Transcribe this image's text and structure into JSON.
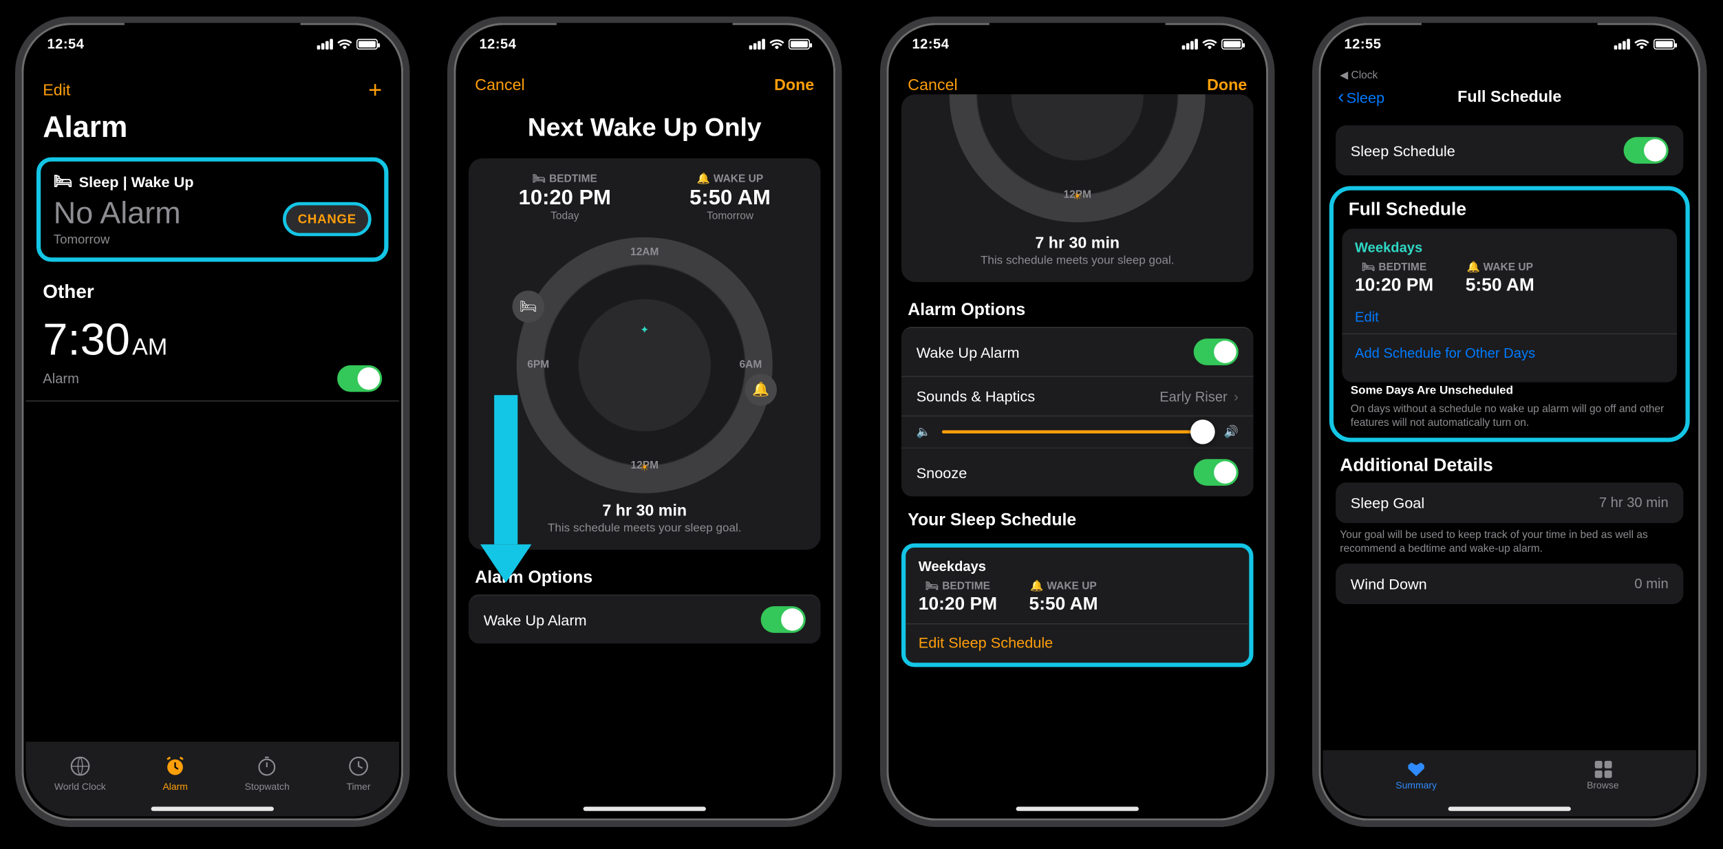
{
  "colors": {
    "accent": "#ff9f0a",
    "highlight": "#14c6e6",
    "toggle_on": "#34c759",
    "link_blue": "#007aff",
    "teal": "#2fd8c5"
  },
  "status": {
    "time_a": "12:54",
    "time_b": "12:55"
  },
  "s1": {
    "edit": "Edit",
    "title": "Alarm",
    "sleep_section": "Sleep | Wake Up",
    "no_alarm": "No Alarm",
    "tomorrow": "Tomorrow",
    "change": "CHANGE",
    "other": "Other",
    "alarm_time": "7:30",
    "alarm_ampm": "AM",
    "alarm_label": "Alarm",
    "tabs": [
      "World Clock",
      "Alarm",
      "Stopwatch",
      "Timer"
    ]
  },
  "s2": {
    "cancel": "Cancel",
    "done": "Done",
    "title": "Next Wake Up Only",
    "bedtime_lbl": "BEDTIME",
    "wake_lbl": "WAKE UP",
    "bedtime": "10:20 PM",
    "wake": "5:50 AM",
    "bedtime_sub": "Today",
    "wake_sub": "Tomorrow",
    "dial_12am": "12AM",
    "dial_6am": "6AM",
    "dial_12pm": "12PM",
    "dial_6pm": "6PM",
    "duration": "7 hr 30 min",
    "meet_goal": "This schedule meets your sleep goal.",
    "alarm_options": "Alarm Options",
    "wake_alarm": "Wake Up Alarm"
  },
  "s3": {
    "cancel": "Cancel",
    "done": "Done",
    "duration": "7 hr 30 min",
    "meet_goal": "This schedule meets your sleep goal.",
    "alarm_options": "Alarm Options",
    "wake_alarm": "Wake Up Alarm",
    "sounds": "Sounds & Haptics",
    "sounds_val": "Early Riser",
    "snooze": "Snooze",
    "your_sched": "Your Sleep Schedule",
    "weekdays": "Weekdays",
    "bedtime_lbl": "BEDTIME",
    "wake_lbl": "WAKE UP",
    "bedtime": "10:20 PM",
    "wake": "5:50 AM",
    "edit_sched": "Edit Sleep Schedule"
  },
  "s4": {
    "breadcrumb": "◀︎ Clock",
    "back": "Sleep",
    "title": "Full Schedule",
    "sleep_schedule": "Sleep Schedule",
    "full_schedule": "Full Schedule",
    "weekdays": "Weekdays",
    "bedtime_lbl": "BEDTIME",
    "wake_lbl": "WAKE UP",
    "bedtime": "10:20 PM",
    "wake": "5:50 AM",
    "edit": "Edit",
    "add_other": "Add Schedule for Other Days",
    "note_hdr": "Some Days Are Unscheduled",
    "note": "On days without a schedule no wake up alarm will go off and other features will not automatically turn on.",
    "additional": "Additional Details",
    "sleep_goal": "Sleep Goal",
    "sleep_goal_val": "7 hr 30 min",
    "goal_note": "Your goal will be used to keep track of your time in bed as well as recommend a bedtime and wake-up alarm.",
    "wind_down": "Wind Down",
    "wind_down_val": "0 min",
    "tab_summary": "Summary",
    "tab_browse": "Browse"
  }
}
